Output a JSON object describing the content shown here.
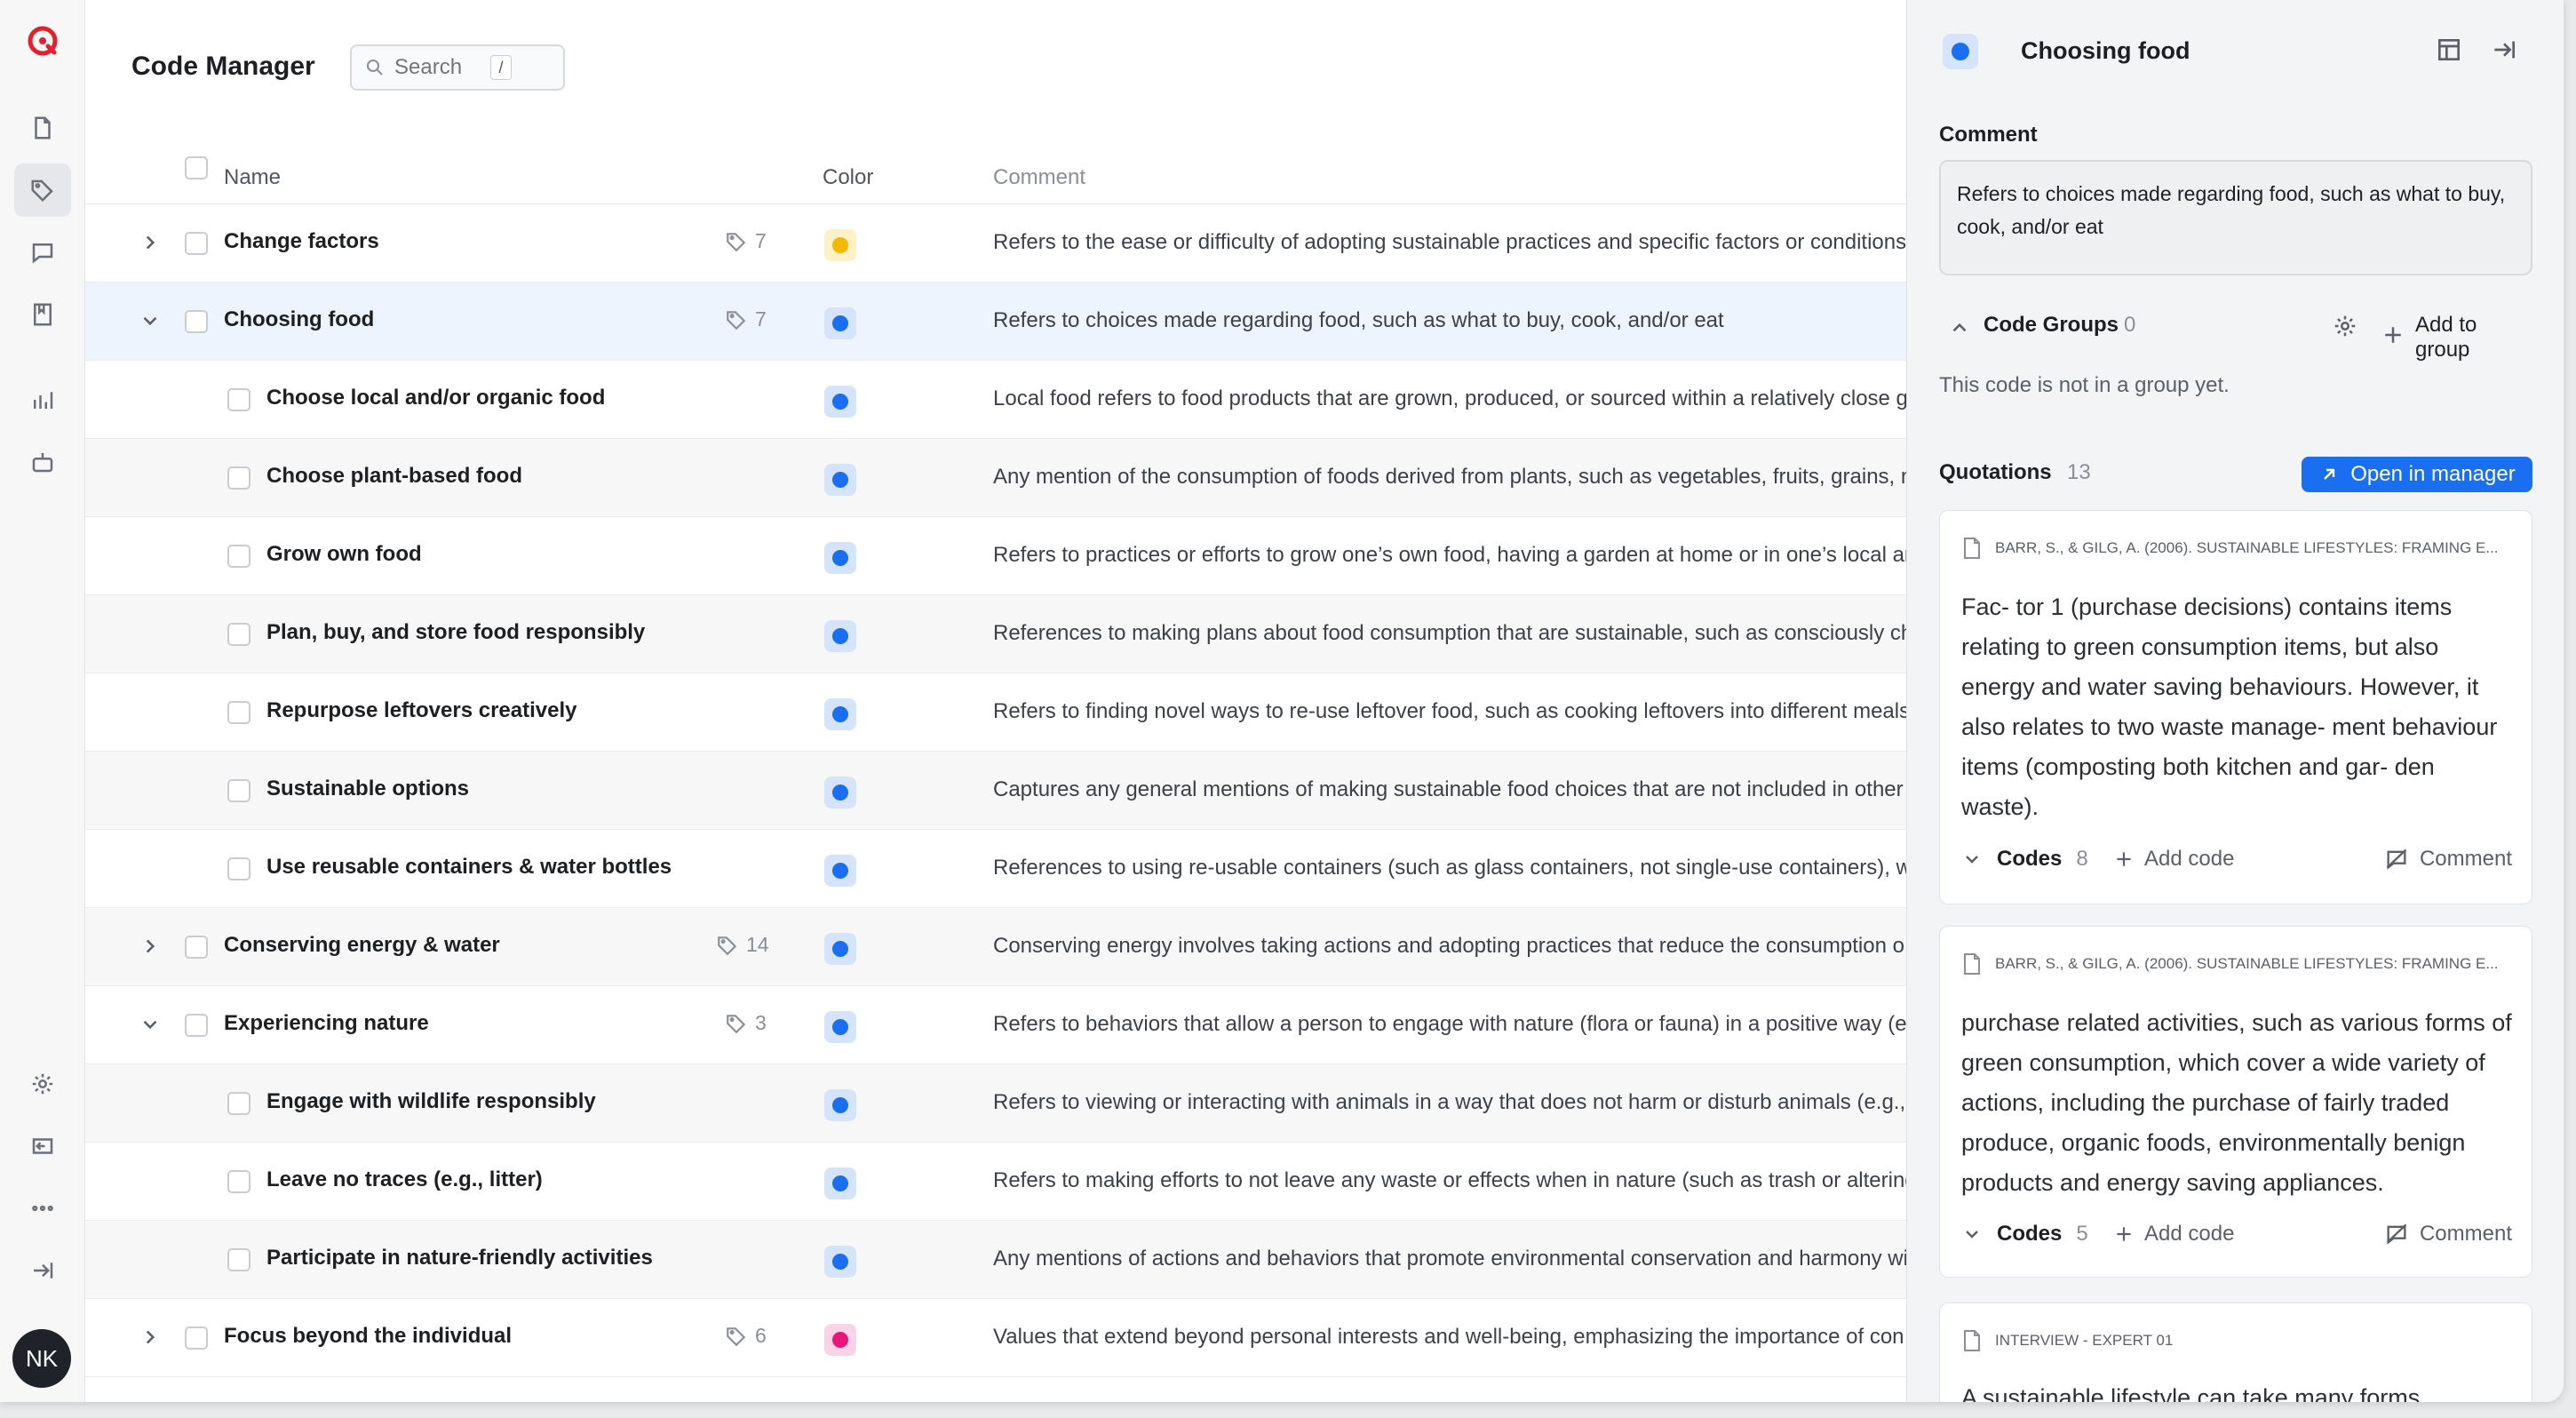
{
  "app": {
    "title": "Code Manager",
    "user_initials": "NK"
  },
  "search": {
    "placeholder": "Search",
    "shortcut": "/"
  },
  "table": {
    "headers": {
      "name": "Name",
      "color": "Color",
      "comment": "Comment"
    },
    "rows": [
      {
        "name": "Change factors",
        "count": "7",
        "level": 0,
        "chevron": "right",
        "color": "#f5b800",
        "swatch_bg": "#fdf1c6",
        "comment": "Refers to the ease or difficulty of adopting sustainable practices and specific factors or conditions"
      },
      {
        "name": "Choosing food",
        "count": "7",
        "level": 0,
        "chevron": "down",
        "color": "#1a6ef0",
        "swatch_bg": "#d6e4fb",
        "comment": "Refers to choices made regarding food, such as what to buy, cook, and/or eat"
      },
      {
        "name": "Choose local and/or organic food",
        "count": "",
        "level": 1,
        "chevron": "",
        "color": "#1a6ef0",
        "swatch_bg": "#d6e4fb",
        "comment": "Local food refers to food products that are grown, produced, or sourced within a relatively close g"
      },
      {
        "name": "Choose plant-based food",
        "count": "",
        "level": 1,
        "chevron": "",
        "color": "#1a6ef0",
        "swatch_bg": "#d6e4fb",
        "comment": "Any mention of the consumption of foods derived from plants, such as vegetables, fruits, grains, n"
      },
      {
        "name": "Grow own food",
        "count": "",
        "level": 1,
        "chevron": "",
        "color": "#1a6ef0",
        "swatch_bg": "#d6e4fb",
        "comment": "Refers to practices or efforts to grow one’s own food, having a garden at home or in one’s local are"
      },
      {
        "name": "Plan, buy, and store food responsibly",
        "count": "",
        "level": 1,
        "chevron": "",
        "color": "#1a6ef0",
        "swatch_bg": "#d6e4fb",
        "comment": "References to making plans about food consumption that are sustainable, such as consciously ch"
      },
      {
        "name": "Repurpose leftovers creatively",
        "count": "",
        "level": 1,
        "chevron": "",
        "color": "#1a6ef0",
        "swatch_bg": "#d6e4fb",
        "comment": "Refers to finding novel ways to re-use leftover food, such as cooking leftovers into different meals"
      },
      {
        "name": "Sustainable options",
        "count": "",
        "level": 1,
        "chevron": "",
        "color": "#1a6ef0",
        "swatch_bg": "#d6e4fb",
        "comment": "Captures any general mentions of making sustainable food choices that are not included in other"
      },
      {
        "name": "Use reusable containers & water bottles",
        "count": "",
        "level": 1,
        "chevron": "",
        "color": "#1a6ef0",
        "swatch_bg": "#d6e4fb",
        "comment": "References to using re-usable containers (such as glass containers, not single-use containers), wh"
      },
      {
        "name": "Conserving energy & water",
        "count": "14",
        "level": 0,
        "chevron": "right",
        "color": "#1a6ef0",
        "swatch_bg": "#d6e4fb",
        "comment": "Conserving energy involves taking actions and adopting practices that reduce the consumption o"
      },
      {
        "name": "Experiencing nature",
        "count": "3",
        "level": 0,
        "chevron": "down",
        "color": "#1a6ef0",
        "swatch_bg": "#d6e4fb",
        "comment": "Refers to behaviors that allow a person to engage with nature (flora or fauna) in a positive way (e.g"
      },
      {
        "name": "Engage with wildlife responsibly",
        "count": "",
        "level": 1,
        "chevron": "",
        "color": "#1a6ef0",
        "swatch_bg": "#d6e4fb",
        "comment": "Refers to viewing or interacting with animals in a way that does not harm or disturb animals (e.g.,"
      },
      {
        "name": "Leave no traces (e.g., litter)",
        "count": "",
        "level": 1,
        "chevron": "",
        "color": "#1a6ef0",
        "swatch_bg": "#d6e4fb",
        "comment": "Refers to making efforts to not leave any waste or effects when in nature (such as trash or altering"
      },
      {
        "name": "Participate in nature-friendly activities",
        "count": "",
        "level": 1,
        "chevron": "",
        "color": "#1a6ef0",
        "swatch_bg": "#d6e4fb",
        "comment": "Any mentions of actions and behaviors that promote environmental conservation and harmony wi"
      },
      {
        "name": "Focus beyond the individual",
        "count": "6",
        "level": 0,
        "chevron": "right",
        "color": "#e8167a",
        "swatch_bg": "#fbd3e6",
        "comment": "Values that extend beyond personal interests and well-being, emphasizing the importance of con"
      }
    ]
  },
  "panel": {
    "title": "Choosing food",
    "accent": "#1a6ef0",
    "comment_label": "Comment",
    "comment_text": "Refers to choices made regarding food, such as what to buy, cook, and/or eat",
    "code_groups_label": "Code Groups",
    "code_groups_count": "0",
    "add_to_group": "Add to group",
    "groups_empty": "This code is not in a group yet.",
    "quotations_label": "Quotations",
    "quotations_count": "13",
    "open_in_manager": "Open in manager",
    "quotations": [
      {
        "source": "BARR, S., & GILG, A. (2006). SUSTAINABLE LIFESTYLES: FRAMING E...",
        "text": "Fac- tor 1 (purchase decisions) contains items relating to green consumption items, but also energy and water saving behaviours. However, it also relates to two waste manage- ment behaviour items (composting both kitchen and gar- den waste).",
        "codes_label": "Codes",
        "codes_count": "8",
        "add_code": "Add code",
        "comment": "Comment"
      },
      {
        "source": "BARR, S., & GILG, A. (2006). SUSTAINABLE LIFESTYLES: FRAMING E...",
        "text": "purchase related activities, such as various forms of green consumption, which cover a wide variety of actions, including the purchase of fairly traded produce, organic foods, environmentally benign products and energy saving appliances.",
        "codes_label": "Codes",
        "codes_count": "5",
        "add_code": "Add code",
        "comment": "Comment"
      },
      {
        "source": "INTERVIEW - EXPERT 01",
        "text": "A sustainable lifestyle can take many forms"
      }
    ]
  }
}
